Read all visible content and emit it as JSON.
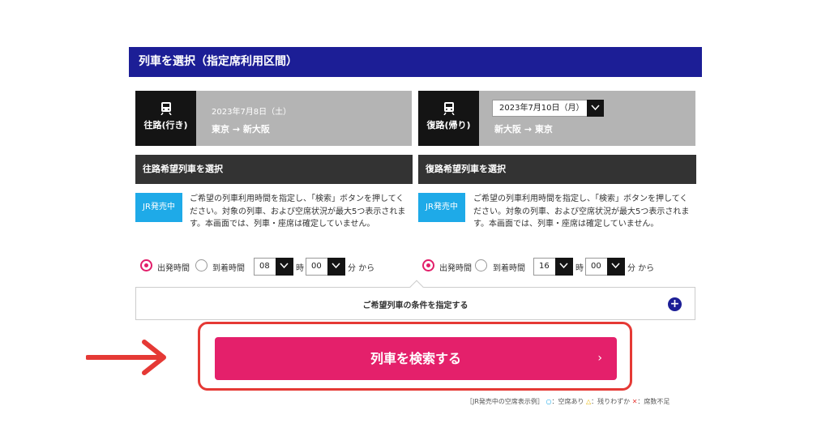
{
  "header": {
    "title": "列車を選択（指定席利用区間）"
  },
  "outbound": {
    "badge_label": "往路(行き)",
    "date": "2023年7月8日（土）",
    "stations": "東京 → 新大阪",
    "section_title": "往路希望列車を選択",
    "jr_badge": "JR発売中",
    "description": "ご希望の列車利用時間を指定し、「検索」ボタンを押してください。対象の列車、および空席状況が最大5つ表示されます。本画面では、列車・座席は確定していません。",
    "departure_label": "出発時間",
    "arrival_label": "到着時間",
    "hour": "08",
    "hour_unit": "時",
    "minute": "00",
    "minute_unit": "分 から"
  },
  "return": {
    "badge_label": "復路(帰り)",
    "date": "2023年7月10日（月）",
    "stations": "新大阪 → 東京",
    "section_title": "復路希望列車を選択",
    "jr_badge": "JR発売中",
    "description": "ご希望の列車利用時間を指定し、「検索」ボタンを押してください。対象の列車、および空席状況が最大5つ表示されます。本画面では、列車・座席は確定していません。",
    "departure_label": "出発時間",
    "arrival_label": "到着時間",
    "hour": "16",
    "hour_unit": "時",
    "minute": "00",
    "minute_unit": "分 から"
  },
  "conditions": {
    "label": "ご希望列車の条件を指定する",
    "icon": "plus-circle-icon"
  },
  "search_button": {
    "label": "列車を検索する",
    "chevron": "›"
  },
  "legend": {
    "prefix": "［JR発売中の空席表示例］",
    "available_symbol": "○",
    "available_label": "：空席あり",
    "few_symbol": "△",
    "few_label": "：残りわずか",
    "none_symbol": "✕",
    "none_label": "：席数不足"
  },
  "colors": {
    "header_bg": "#1c1e96",
    "route_bg": "#b4b4b4",
    "badge_bg": "#141414",
    "jr_badge_bg": "#1eaae8",
    "accent": "#e4206b",
    "highlight": "#e53935"
  }
}
